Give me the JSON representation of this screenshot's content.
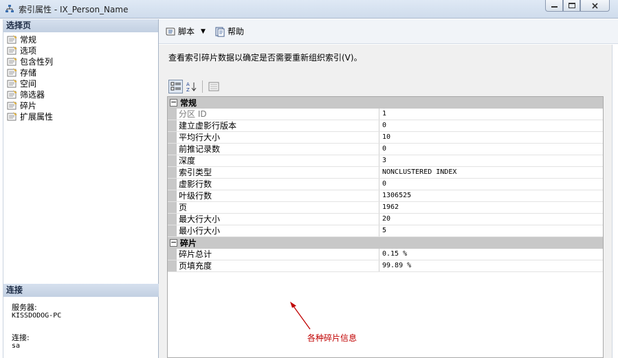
{
  "window": {
    "title": "索引属性 - IX_Person_Name"
  },
  "left": {
    "select_page_header": "选择页",
    "pages": [
      {
        "label": "常规"
      },
      {
        "label": "选项"
      },
      {
        "label": "包含性列"
      },
      {
        "label": "存储"
      },
      {
        "label": "空间"
      },
      {
        "label": "筛选器"
      },
      {
        "label": "碎片"
      },
      {
        "label": "扩展属性"
      }
    ],
    "connection_header": "连接",
    "server_label": "服务器:",
    "server_value": "KISSDODOG-PC",
    "connection_label": "连接:",
    "connection_value": "sa"
  },
  "toolbar": {
    "script_label": "脚本",
    "help_label": "帮助"
  },
  "content": {
    "description": "查看索引碎片数据以确定是否需要重新组织索引(V)。"
  },
  "grid": {
    "categories": [
      {
        "label": "常规",
        "rows": [
          {
            "name": "分区 ID",
            "value": "1",
            "dim": true
          },
          {
            "name": "建立虚影行版本",
            "value": "0"
          },
          {
            "name": "平均行大小",
            "value": "10"
          },
          {
            "name": "前推记录数",
            "value": "0"
          },
          {
            "name": "深度",
            "value": "3"
          },
          {
            "name": "索引类型",
            "value": "NONCLUSTERED INDEX"
          },
          {
            "name": "虚影行数",
            "value": "0"
          },
          {
            "name": "叶级行数",
            "value": "1306525"
          },
          {
            "name": "页",
            "value": "1962"
          },
          {
            "name": "最大行大小",
            "value": "20"
          },
          {
            "name": "最小行大小",
            "value": "5"
          }
        ]
      },
      {
        "label": "碎片",
        "rows": [
          {
            "name": "碎片总计",
            "value": "0.15 %"
          },
          {
            "name": "页填充度",
            "value": "99.89 %"
          }
        ]
      }
    ]
  },
  "annotation": {
    "text": "各种碎片信息",
    "color": "#c00000"
  }
}
